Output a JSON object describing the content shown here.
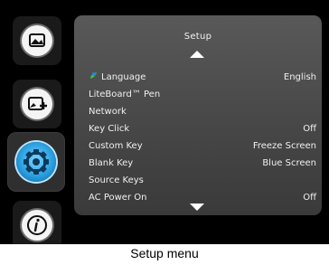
{
  "rail": {
    "items": [
      {
        "icon": "picture-icon",
        "active": false
      },
      {
        "icon": "picture-plus-icon",
        "active": false
      },
      {
        "icon": "settings-gear-icon",
        "active": true
      },
      {
        "icon": "info-icon",
        "active": false
      }
    ]
  },
  "menu": {
    "title": "Setup",
    "rows": [
      {
        "label": "Language",
        "value": "English",
        "icon": "language-icon"
      },
      {
        "label": "LiteBoard™ Pen",
        "value": ""
      },
      {
        "label": "Network",
        "value": ""
      },
      {
        "label": "Key Click",
        "value": "Off"
      },
      {
        "label": "Custom Key",
        "value": "Freeze Screen"
      },
      {
        "label": "Blank Key",
        "value": "Blue Screen"
      },
      {
        "label": "Source Keys",
        "value": ""
      },
      {
        "label": "AC Power On",
        "value": "Off"
      }
    ]
  },
  "caption": "Setup menu",
  "colors": {
    "panel": "#4a4a4a",
    "accent": "#2aa0e0",
    "text": "#f0f0f0"
  }
}
